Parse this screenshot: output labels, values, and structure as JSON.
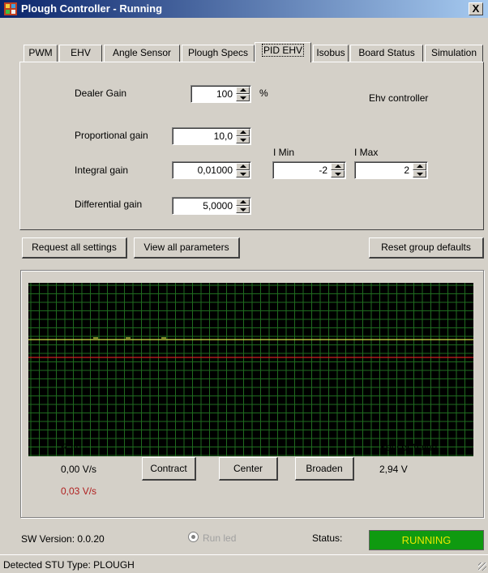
{
  "window": {
    "title": "Plough Controller - Running",
    "close": "X"
  },
  "tabs": [
    "PWM",
    "EHV",
    "Angle Sensor",
    "Plough Specs",
    "PID EHV",
    "Isobus",
    "Board Status",
    "Simulation"
  ],
  "pid": {
    "dealer_gain_label": "Dealer Gain",
    "dealer_gain_value": "100",
    "dealer_gain_unit": "%",
    "ehv_controller_label": "Ehv controller",
    "proportional_label": "Proportional gain",
    "proportional_value": "10,0",
    "integral_label": "Integral gain",
    "integral_value": "0,01000",
    "differential_label": "Differential gain",
    "differential_value": "5,0000",
    "imin_label": "I Min",
    "imin_value": "-2",
    "imax_label": "I Max",
    "imax_value": "2"
  },
  "actions": {
    "request_all": "Request all settings",
    "view_all": "View all parameters",
    "reset_group": "Reset group defaults"
  },
  "monitor": {
    "rate_label": "Rate:",
    "rate_value": "0,00 V/s",
    "rate_value_red": "0,03 V/s",
    "contract": "Contract",
    "center": "Center",
    "broaden": "Broaden",
    "sensor_label": "Sensor Value",
    "sensor_value": "2,94 V"
  },
  "footer": {
    "sw_version": "SW Version: 0.0.20",
    "run_led": "Run led",
    "status_label": "Status:",
    "status_value": "RUNNING",
    "detected": "Detected STU Type: PLOUGH"
  },
  "colors": {
    "graph_bg": "#000000",
    "grid": "#1f6b1f",
    "trace_yellow": "#d8e24a",
    "trace_red": "#d02020",
    "status_bg": "#0f9a10",
    "status_text": "#e8e800"
  }
}
